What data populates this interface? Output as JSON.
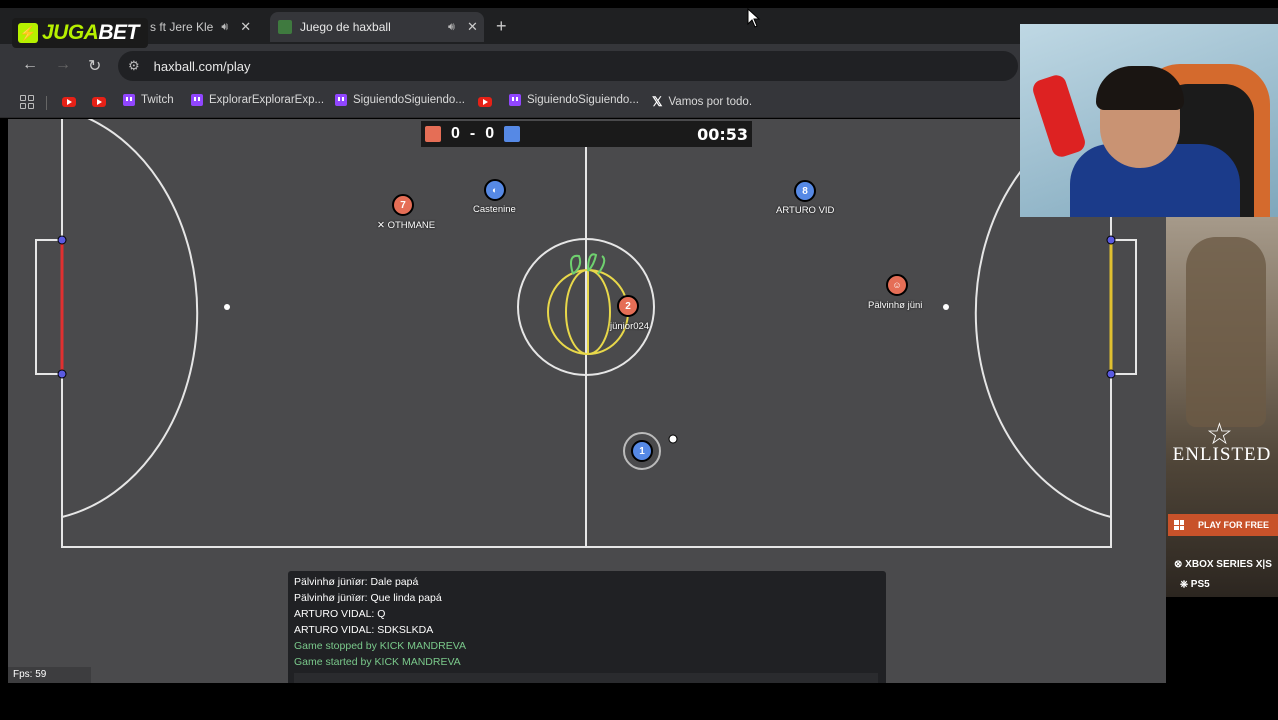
{
  "browser": {
    "tabs": [
      {
        "label": "s ft Jere Kle",
        "active": false
      },
      {
        "label": "Juego de haxball",
        "active": true
      }
    ],
    "address": "haxball.com/play",
    "bookmarks": [
      "Twitch",
      "ExplorarExplorarExp...",
      "SiguiendoSiguiendo...",
      "SiguiendoSiguiendo...",
      "Vamos por todo."
    ]
  },
  "overlay": {
    "logo_left": "JUGA",
    "logo_right": "BET",
    "logo_bolt": "⚡"
  },
  "game": {
    "score_red": "0",
    "score_sep": "-",
    "score_blue": "0",
    "time": "00:53",
    "players": [
      {
        "number": "7",
        "team": "red",
        "name": "OTHMANE",
        "prefix": "✕"
      },
      {
        "number": "",
        "team": "blue",
        "name": "Castenine"
      },
      {
        "number": "8",
        "team": "blue",
        "name": "ARTURO VID"
      },
      {
        "number": "2",
        "team": "red",
        "name": "jünior024"
      },
      {
        "number": "",
        "team": "red",
        "name": "Pälvinhø jüni"
      },
      {
        "number": "1",
        "team": "blue",
        "name": ""
      }
    ],
    "chat": [
      {
        "text": "Pälvinhø jünïør: Dale papá",
        "system": false
      },
      {
        "text": "Pälvinhø jünïør: Que linda papá",
        "system": false
      },
      {
        "text": "ARTURO VIDAL: Q",
        "system": false
      },
      {
        "text": "ARTURO VIDAL: SDKSLKDA",
        "system": false
      },
      {
        "text": "Game stopped by KICK MANDREVA",
        "system": true
      },
      {
        "text": "Game started by KICK MANDREVA",
        "system": true
      }
    ],
    "fps": "Fps: 59",
    "colors": {
      "red": "#e56e56",
      "blue": "#5689e5",
      "field": "#4a4a4c"
    }
  },
  "ad": {
    "brand": "ENLISTED",
    "cta": "PLAY FOR FREE",
    "platform1": "XBOX SERIES X|S",
    "platform2": "PS5"
  }
}
